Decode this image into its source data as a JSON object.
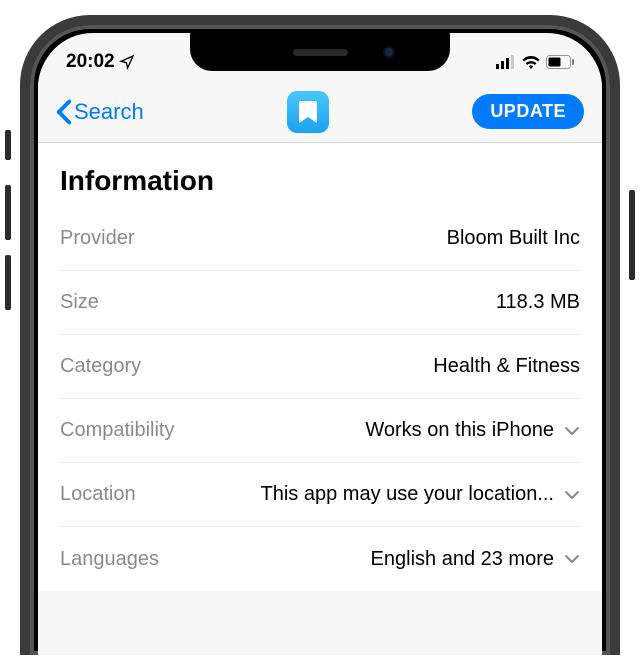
{
  "status": {
    "time": "20:02"
  },
  "nav": {
    "back_label": "Search",
    "update_label": "UPDATE"
  },
  "section_title": "Information",
  "rows": {
    "provider": {
      "label": "Provider",
      "value": "Bloom Built Inc"
    },
    "size": {
      "label": "Size",
      "value": "118.3 MB"
    },
    "category": {
      "label": "Category",
      "value": "Health & Fitness"
    },
    "compatibility": {
      "label": "Compatibility",
      "value": "Works on this iPhone"
    },
    "location": {
      "label": "Location",
      "value": "This app may use your location..."
    },
    "languages": {
      "label": "Languages",
      "value": "English and 23 more"
    }
  }
}
